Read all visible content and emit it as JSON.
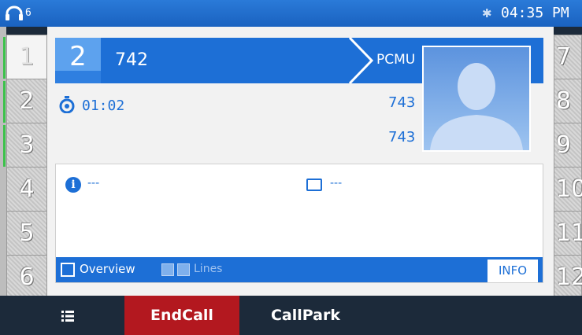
{
  "status_bar": {
    "account_number": "6",
    "headset_icon": "headset-icon",
    "bluetooth_icon": "bluetooth-icon",
    "time": "04:35 PM"
  },
  "line_keys_left": [
    {
      "label": "1",
      "active": true
    },
    {
      "label": "2",
      "active": false
    },
    {
      "label": "3",
      "active": false
    },
    {
      "label": "4",
      "active": false
    },
    {
      "label": "5",
      "active": false
    },
    {
      "label": "6",
      "active": false
    }
  ],
  "line_keys_right": [
    {
      "label": "7"
    },
    {
      "label": "8"
    },
    {
      "label": "9"
    },
    {
      "label": "10"
    },
    {
      "label": "11"
    },
    {
      "label": "12"
    }
  ],
  "call": {
    "line_number": "2",
    "callee": "742",
    "codec": "PCMU",
    "duration": "01:02",
    "caller_number_1": "743",
    "caller_number_2": "743"
  },
  "info_panel": {
    "info_value": "---",
    "card_value": "---",
    "overview_label": "Overview",
    "lines_label": "Lines",
    "info_tab": "INFO"
  },
  "softkeys": {
    "endcall": "EndCall",
    "callpark": "CallPark"
  },
  "colors": {
    "accent": "#1d6fd6",
    "status_bar": "#1a62c0",
    "endcall": "#b3181f",
    "led": "#3bc24a"
  }
}
